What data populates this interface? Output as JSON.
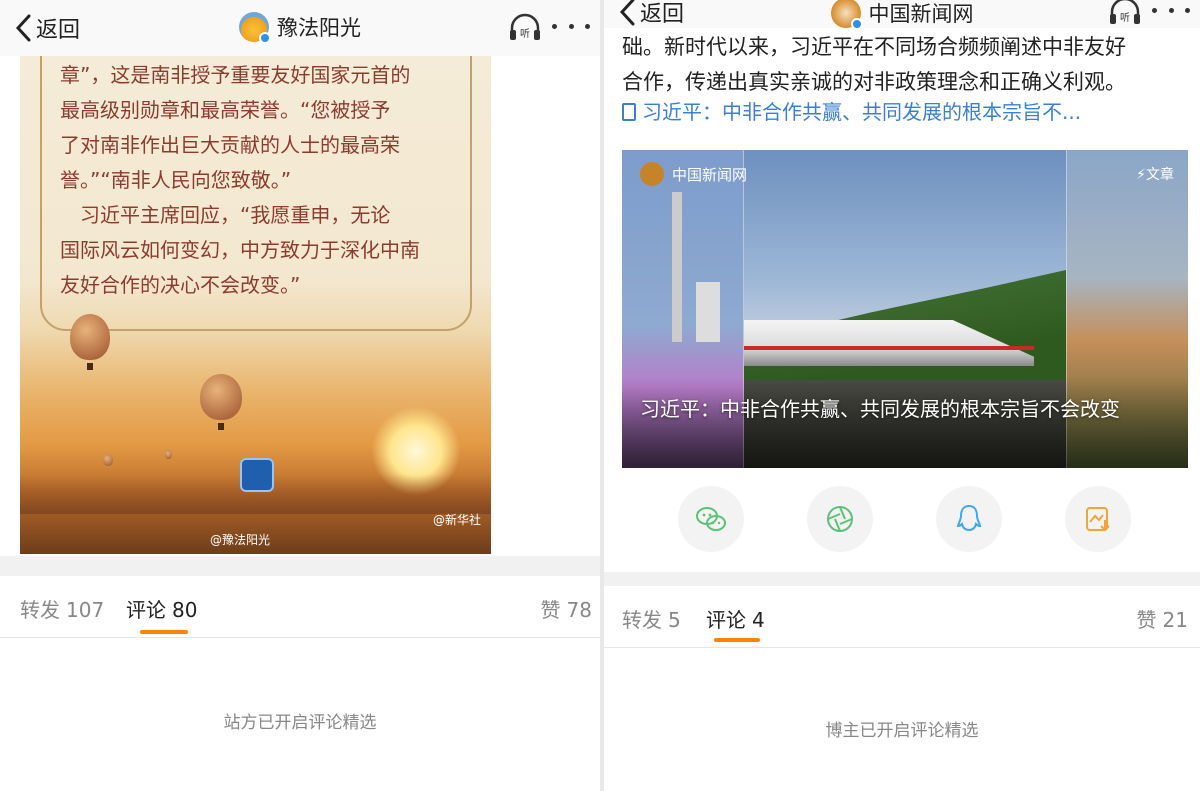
{
  "left": {
    "topbar": {
      "back_label": "返回",
      "title": "豫法阳光"
    },
    "poem_lines": [
      "章”，这是南非授予重要友好国家元首的",
      "最高级别勋章和最高荣誉。“您被授予",
      "了对南非作出巨大贡献的人士的最高荣",
      "誉。”“南非人民向您致敬。”",
      "　习近平主席回应，“我愿重申，无论",
      "国际风云如何变幻，中方致力于深化中南",
      "友好合作的决心不会改变。”"
    ],
    "watermark_xinhua": "@新华社",
    "watermark_account": "@豫法阳光",
    "tabs": {
      "repost": "转发",
      "repost_count": "107",
      "comment": "评论",
      "comment_count": "80",
      "like": "赞",
      "like_count": "78"
    },
    "notice": "站方已开启评论精选"
  },
  "right": {
    "topbar": {
      "back_label": "返回",
      "title": "中国新闻网"
    },
    "text_lines": [
      "础。新时代以来，习近平在不同场合频频阐述中非友好",
      "合作，传递出真实亲诚的对非政策理念和正确义利观。"
    ],
    "link_text": "习近平：中非合作共赢、共同发展的根本宗旨不...",
    "card": {
      "source": "中国新闻网",
      "tag": "⚡文章",
      "title": "习近平：中非合作共赢、共同发展的根本宗旨不会改变"
    },
    "share": [
      "wechat-icon",
      "moments-icon",
      "qq-icon",
      "save-image-icon"
    ],
    "tabs": {
      "repost": "转发",
      "repost_count": "5",
      "comment": "评论",
      "comment_count": "4",
      "like": "赞",
      "like_count": "21"
    },
    "notice": "博主已开启评论精选"
  },
  "colors": {
    "accent": "#ff8200",
    "link": "#3a7fd0",
    "wechat": "#5bc276",
    "qq": "#3ea7f0",
    "save": "#f2a437"
  }
}
